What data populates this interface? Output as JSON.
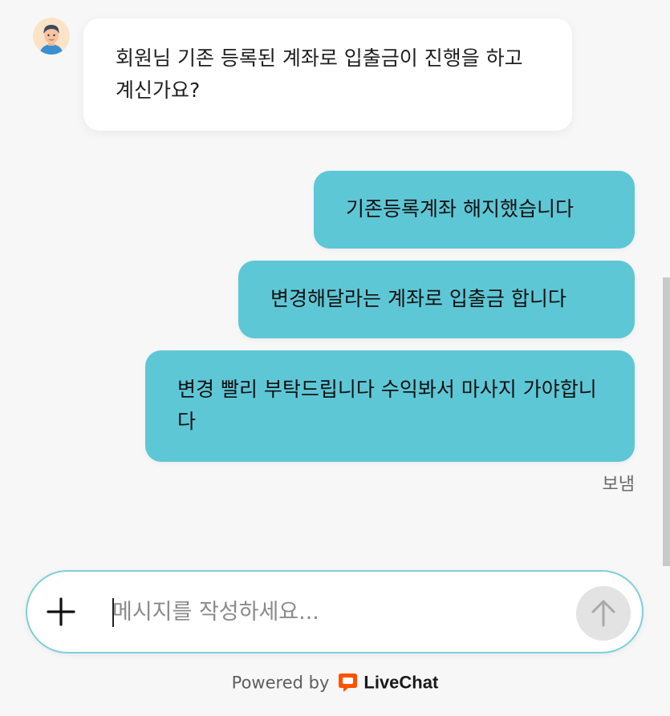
{
  "agent": {
    "avatar_icon": "person-avatar-icon",
    "message": "회원님 기존 등록된 계좌로 입출금이 진행을 하고 계신가요?"
  },
  "user_messages": [
    {
      "text": "기존등록계좌 해지했습니다"
    },
    {
      "text": "변경해달라는 계좌로 입출금 합니다"
    },
    {
      "text": "변경 빨리 부탁드립니다 수익봐서 마사지 가야합니다"
    }
  ],
  "status": "보냄",
  "composer": {
    "placeholder": "메시지를 작성하세요...",
    "value": "",
    "attach_icon": "plus-icon",
    "send_icon": "arrow-up-icon"
  },
  "footer": {
    "powered_by": "Powered by",
    "brand": "LiveChat",
    "logo_icon": "livechat-logo-icon"
  },
  "colors": {
    "outgoing_bubble": "#5ec7d6",
    "incoming_bubble": "#ffffff",
    "background": "#f7f7f7",
    "composer_border": "#7fcfd9",
    "brand_orange": "#ff5100"
  }
}
